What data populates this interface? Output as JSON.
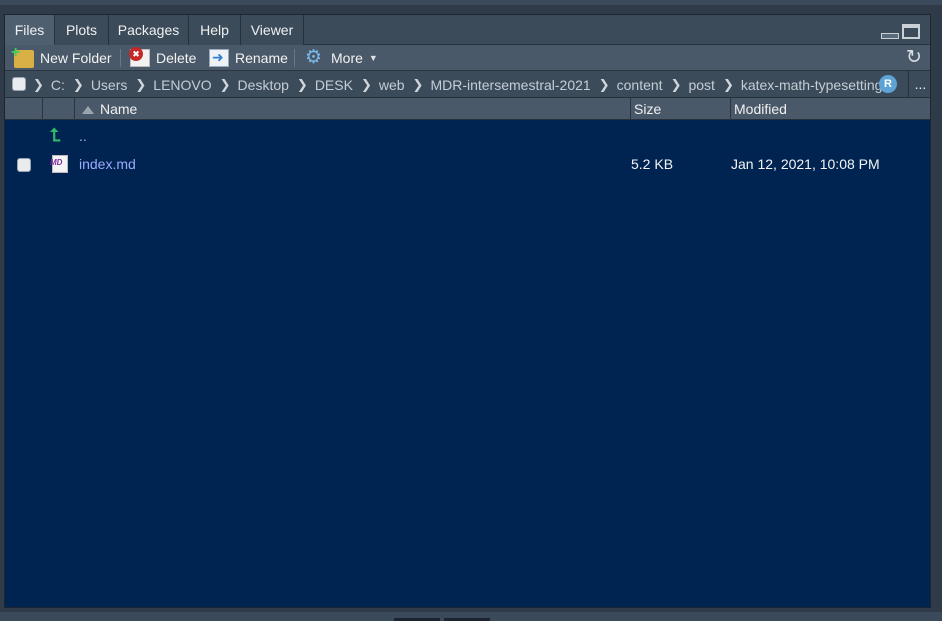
{
  "tabs": [
    {
      "label": "Files",
      "active": true
    },
    {
      "label": "Plots",
      "active": false
    },
    {
      "label": "Packages",
      "active": false
    },
    {
      "label": "Help",
      "active": false
    },
    {
      "label": "Viewer",
      "active": false
    }
  ],
  "toolbar": {
    "new_folder_label": "New Folder",
    "delete_label": "Delete",
    "rename_label": "Rename",
    "more_label": "More",
    "refresh_icon": "refresh-icon"
  },
  "breadcrumb": {
    "items": [
      "C:",
      "Users",
      "LENOVO",
      "Desktop",
      "DESK",
      "web",
      "MDR-intersemestral-2021",
      "content",
      "post",
      "katex-math-typesetting"
    ],
    "project_badge": "R",
    "overflow": "..."
  },
  "columns": {
    "name": "Name",
    "size": "Size",
    "modified": "Modified"
  },
  "files": [
    {
      "name": "..",
      "size": "",
      "modified": "",
      "icon": "up-arrow-icon"
    },
    {
      "name": "index.md",
      "size": "5.2 KB",
      "modified": "Jan 12, 2021, 10:08 PM",
      "icon": "markdown-file-icon"
    }
  ],
  "colors": {
    "pane_background": "#002451",
    "link": "#9ca9ff",
    "toolbar": "#4a5969"
  }
}
